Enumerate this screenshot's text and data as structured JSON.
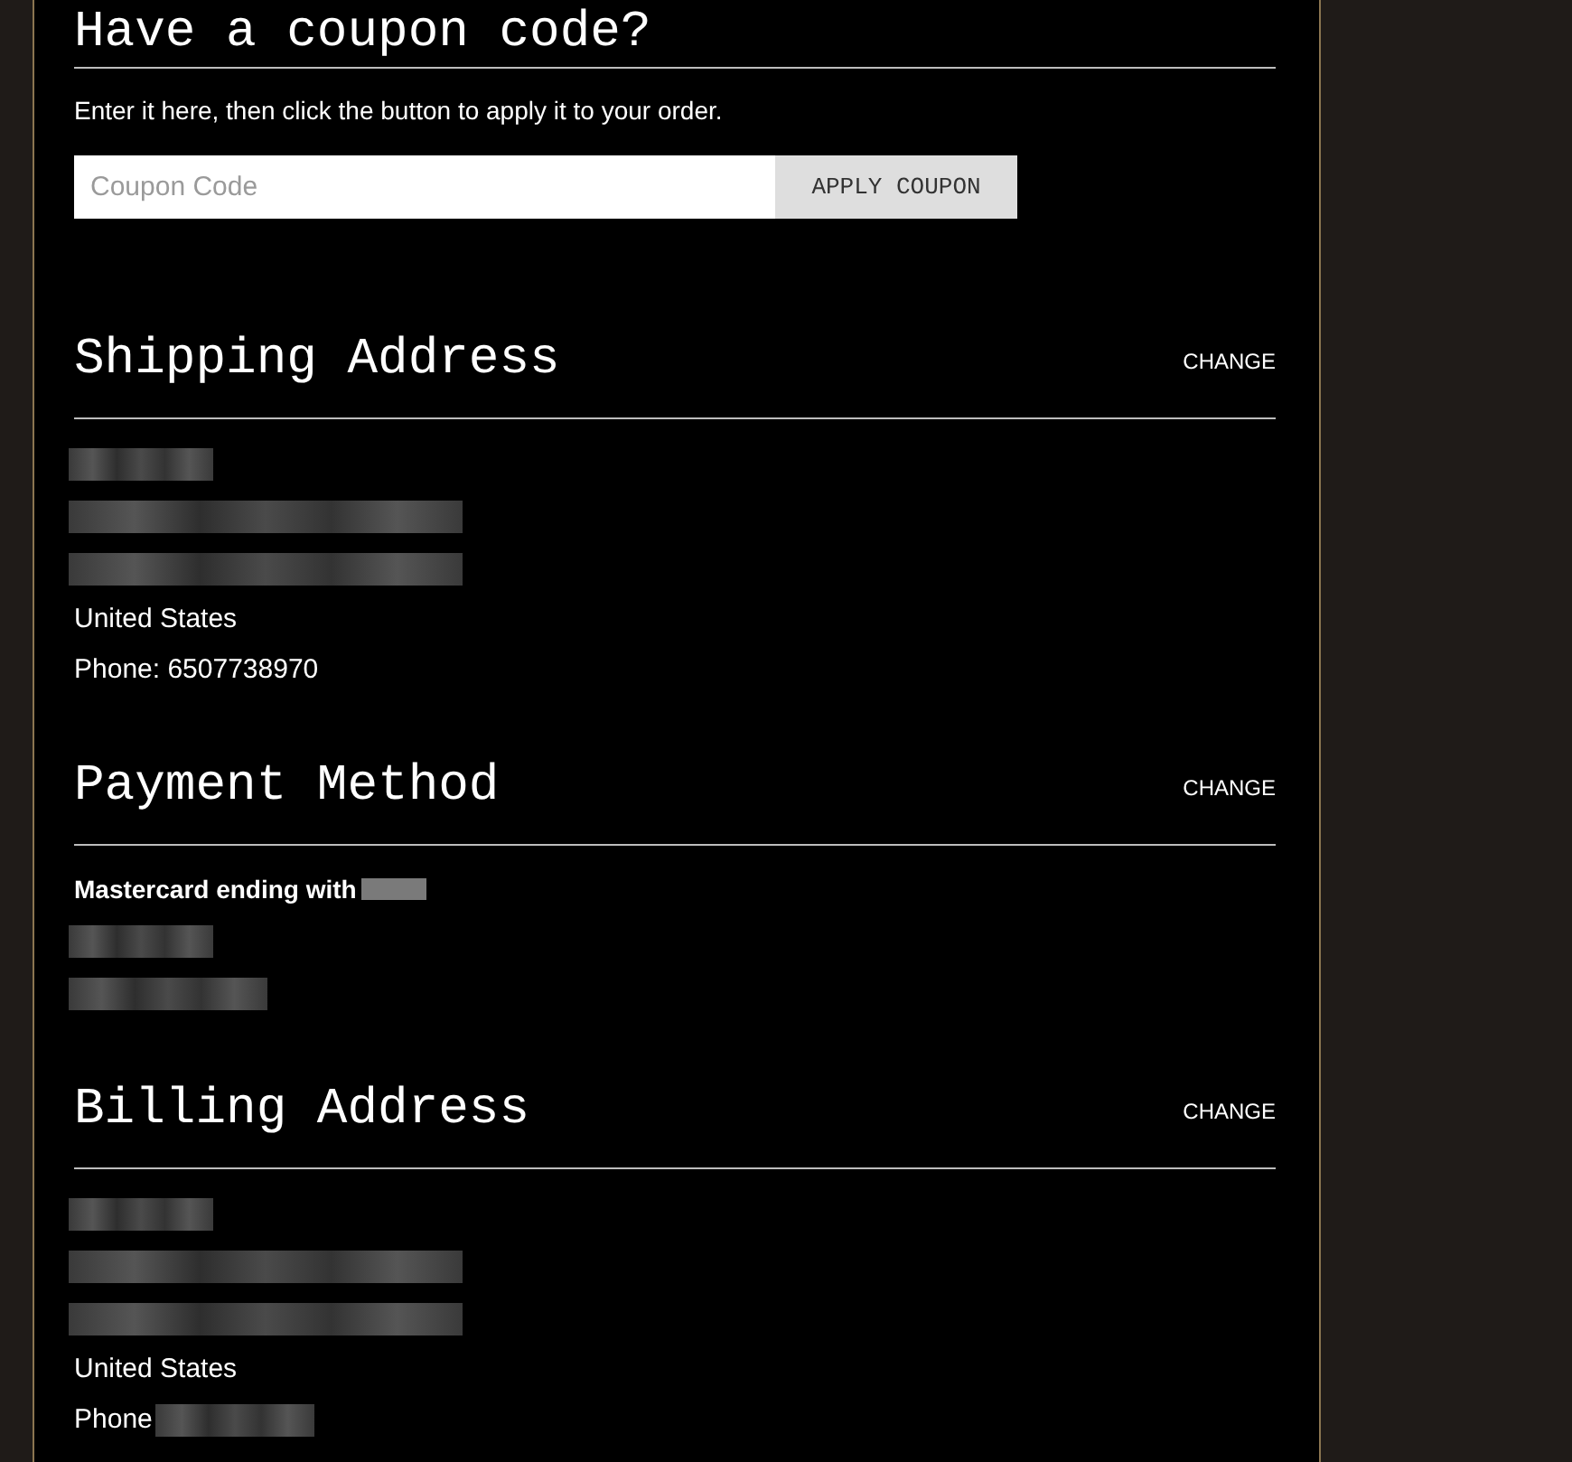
{
  "coupon": {
    "title": "Have a coupon code?",
    "instructions": "Enter it here, then click the button to apply it to your order.",
    "input": {
      "placeholder": "Coupon Code"
    },
    "button": "APPLY COUPON"
  },
  "sections": [
    {
      "title": "Shipping Address",
      "action": "CHANGE",
      "lines": [
        {
          "kind": "redacted_short"
        },
        {
          "kind": "redacted_long"
        },
        {
          "kind": "redacted_long"
        },
        {
          "kind": "text",
          "text": "United States"
        },
        {
          "kind": "text",
          "text": "Phone: 6507738970"
        }
      ]
    },
    {
      "title": "Payment Method",
      "action": "CHANGE",
      "lines": [
        {
          "kind": "bold_with_redacted",
          "text": "Mastercard ending with"
        },
        {
          "kind": "redacted_short"
        },
        {
          "kind": "redacted_medium"
        }
      ]
    },
    {
      "title": "Billing Address",
      "action": "CHANGE",
      "lines": [
        {
          "kind": "redacted_short"
        },
        {
          "kind": "redacted_long"
        },
        {
          "kind": "redacted_long"
        },
        {
          "kind": "text",
          "text": "United States"
        },
        {
          "kind": "text_with_redacted",
          "text": "Phone"
        }
      ]
    }
  ]
}
